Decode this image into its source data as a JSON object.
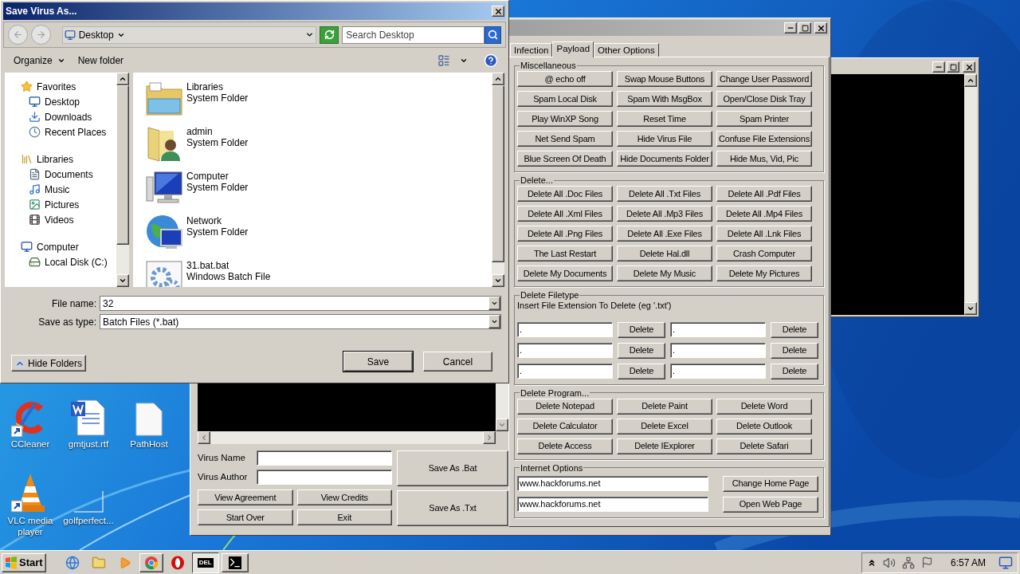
{
  "dialog": {
    "title": "Save Virus As...",
    "location": "Desktop",
    "search": {
      "placeholder": "Search Desktop"
    },
    "organize": "Organize",
    "new_folder": "New folder",
    "nav": [
      {
        "label": "Favorites",
        "kind": "favorites",
        "children": [
          {
            "label": "Desktop",
            "kind": "desktop"
          },
          {
            "label": "Downloads",
            "kind": "downloads"
          },
          {
            "label": "Recent Places",
            "kind": "recent"
          }
        ]
      },
      {
        "label": "Libraries",
        "kind": "libraries",
        "children": [
          {
            "label": "Documents",
            "kind": "documents"
          },
          {
            "label": "Music",
            "kind": "music"
          },
          {
            "label": "Pictures",
            "kind": "pictures"
          },
          {
            "label": "Videos",
            "kind": "videos"
          }
        ]
      },
      {
        "label": "Computer",
        "kind": "computer",
        "children": [
          {
            "label": "Local Disk (C:)",
            "kind": "disk"
          }
        ]
      }
    ],
    "files": [
      {
        "name": "Libraries",
        "type": "System Folder",
        "kind": "libraries"
      },
      {
        "name": "admin",
        "type": "System Folder",
        "kind": "user"
      },
      {
        "name": "Computer",
        "type": "System Folder",
        "kind": "computer"
      },
      {
        "name": "Network",
        "type": "System Folder",
        "kind": "network"
      },
      {
        "name": "31.bat.bat",
        "type": "Windows Batch File",
        "kind": "batch"
      }
    ],
    "file_name": {
      "label": "File name:",
      "value": "32"
    },
    "save_as_type": {
      "label": "Save as type:",
      "value": "Batch Files (*.bat)"
    },
    "hide_folders": "Hide Folders",
    "buttons": [
      "Save",
      "Cancel"
    ]
  },
  "builder": {
    "tabs": [
      {
        "label": "Infection",
        "selected": false
      },
      {
        "label": "Payload",
        "selected": true
      },
      {
        "label": "Other Options",
        "selected": false
      }
    ],
    "groups": [
      {
        "title": "Miscellaneous",
        "kind": "buttons",
        "buttons": [
          "@ echo off",
          "Swap Mouse Buttons",
          "Change User Password",
          "Spam Local Disk",
          "Spam With MsgBox",
          "Open/Close Disk Tray",
          "Play WinXP Song",
          "Reset Time",
          "Spam Printer",
          "Net Send Spam",
          "Hide Virus File",
          "Confuse File Extensions",
          "Blue Screen Of Death",
          "Hide Documents Folder",
          "Hide Mus, Vid, Pic"
        ]
      },
      {
        "title": "Delete...",
        "kind": "buttons",
        "buttons": [
          "Delete All .Doc Files",
          "Delete All .Txt Files",
          "Delete All .Pdf Files",
          "Delete All .Xml Files",
          "Delete All .Mp3 Files",
          "Delete All .Mp4 Files",
          "Delete All .Png Files",
          "Delete All .Exe Files",
          "Delete All .Lnk Files",
          "The Last Restart",
          "Delete Hal.dll",
          "Crash Computer",
          "Delete My Documents",
          "Delete My Music",
          "Delete My Pictures"
        ]
      },
      {
        "title": "Delete Filetype",
        "kind": "filetype",
        "hint": "Insert File Extension To Delete (eg '.txt')",
        "rows": [
          {
            "value": ".",
            "button": "Delete"
          },
          {
            "value": ".",
            "button": "Delete"
          },
          {
            "value": ".",
            "button": "Delete"
          },
          {
            "value": ".",
            "button": "Delete"
          },
          {
            "value": ".",
            "button": "Delete"
          },
          {
            "value": ".",
            "button": "Delete"
          }
        ]
      },
      {
        "title": "Delete Program...",
        "kind": "buttons",
        "buttons": [
          "Delete Notepad",
          "Delete Paint",
          "Delete Word",
          "Delete Calculator",
          "Delete Excel",
          "Delete Outlook",
          "Delete Access",
          "Delete IExplorer",
          "Delete Safari"
        ]
      },
      {
        "title": "Internet Options",
        "kind": "urls",
        "rows": [
          {
            "value": "www.hackforums.net",
            "button": "Change Home Page"
          },
          {
            "value": "www.hackforums.net",
            "button": "Open Web Page"
          }
        ]
      }
    ],
    "virus_name": "Virus Name",
    "virus_author": "Virus Author",
    "left_buttons": [
      "View Agreement",
      "View Credits",
      "Start Over",
      "Exit"
    ],
    "save_buttons": [
      "Save As .Bat",
      "Save As .Txt"
    ]
  },
  "desktop_icons": [
    {
      "label": "CCleaner",
      "kind": "ccleaner"
    },
    {
      "label": "gmtjust.rtf",
      "kind": "word"
    },
    {
      "label": "PathHost",
      "kind": "blank"
    },
    {
      "label": "VLC media player",
      "kind": "vlc"
    },
    {
      "label": "golfperfect...",
      "kind": "empty"
    }
  ],
  "taskbar": {
    "start": "Start",
    "apps": [
      {
        "kind": "ie"
      },
      {
        "kind": "explorer"
      },
      {
        "kind": "media"
      },
      {
        "kind": "chrome"
      },
      {
        "kind": "opera"
      },
      {
        "kind": "batch",
        "label": "DEL"
      },
      {
        "kind": "console"
      }
    ],
    "clock": "6:57 AM"
  }
}
